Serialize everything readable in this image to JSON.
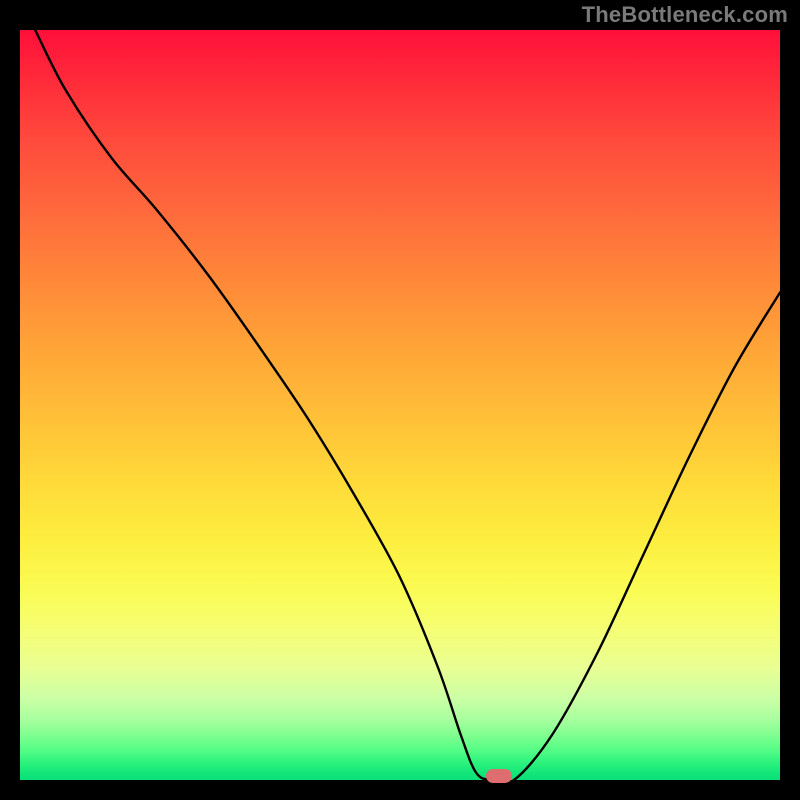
{
  "watermark": "TheBottleneck.com",
  "chart_data": {
    "type": "line",
    "title": "",
    "xlabel": "",
    "ylabel": "",
    "xlim": [
      0,
      100
    ],
    "ylim": [
      0,
      100
    ],
    "series": [
      {
        "name": "bottleneck-curve",
        "x": [
          2,
          6,
          12,
          18,
          25,
          32,
          38,
          44,
          50,
          55,
          58,
          60,
          62,
          65,
          70,
          76,
          82,
          88,
          94,
          100
        ],
        "values": [
          100,
          92,
          83,
          76,
          67,
          57,
          48,
          38,
          27,
          15,
          6,
          1,
          0,
          0,
          6,
          17,
          30,
          43,
          55,
          65
        ]
      }
    ],
    "marker": {
      "x": 63,
      "y": 0.5,
      "color": "#dd6d6e"
    },
    "gradient_stops": [
      {
        "pct": 0,
        "color": "#ff0e3a"
      },
      {
        "pct": 50,
        "color": "#ffcc38"
      },
      {
        "pct": 80,
        "color": "#f7fe68"
      },
      {
        "pct": 100,
        "color": "#0adf78"
      }
    ]
  }
}
